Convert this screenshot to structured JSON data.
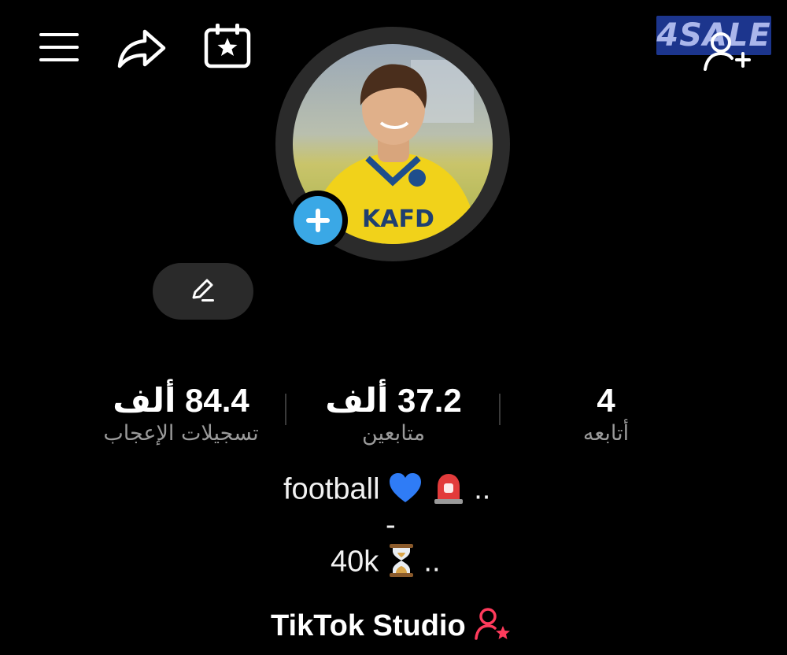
{
  "watermark": "4SALE",
  "icons": {
    "menu": "menu-icon",
    "share": "share-icon",
    "calendar": "calendar-star-icon",
    "add_friend": "add-friend-icon",
    "edit": "pencil-icon",
    "avatar_add": "plus-icon",
    "studio": "person-star-icon"
  },
  "colors": {
    "accent": "#3aa8e6",
    "studio_star": "#ff3b5c"
  },
  "stats": {
    "following": {
      "value": "4",
      "label": "أتابعه"
    },
    "followers": {
      "value": "37.2 ألف",
      "label": "متابعين"
    },
    "likes": {
      "value": "84.4 ألف",
      "label": "تسجيلات الإعجاب"
    }
  },
  "bio": {
    "line1_text": "football",
    "line1_tail": "..",
    "line2": "-",
    "line3_text": "40k",
    "line3_tail": ".."
  },
  "studio": {
    "label": "TikTok Studio"
  }
}
